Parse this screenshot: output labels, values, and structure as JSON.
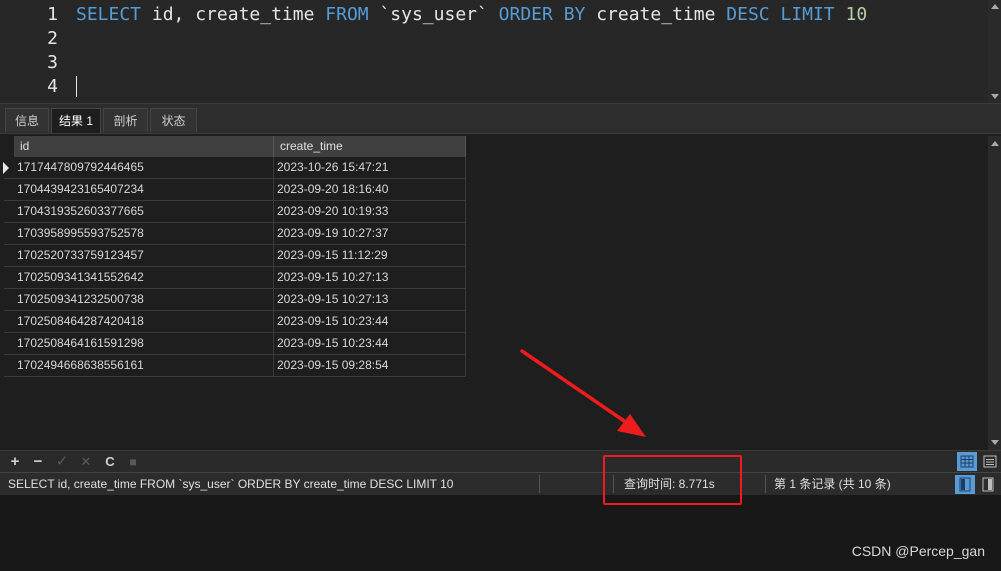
{
  "editor": {
    "line_numbers": [
      "1",
      "2",
      "3",
      "4"
    ],
    "sql_tokens": [
      {
        "text": "SELECT",
        "kind": "kw"
      },
      {
        "text": " id, create_time ",
        "kind": "id"
      },
      {
        "text": "FROM",
        "kind": "kw"
      },
      {
        "text": " `sys_user` ",
        "kind": "id"
      },
      {
        "text": "ORDER BY",
        "kind": "kw"
      },
      {
        "text": " create_time ",
        "kind": "id"
      },
      {
        "text": "DESC LIMIT",
        "kind": "kw"
      },
      {
        "text": " ",
        "kind": "id"
      },
      {
        "text": "10",
        "kind": "num"
      }
    ]
  },
  "tabs": [
    {
      "label": "信息",
      "active": false
    },
    {
      "label": "结果 1",
      "active": true
    },
    {
      "label": "剖析",
      "active": false
    },
    {
      "label": "状态",
      "active": false
    }
  ],
  "grid": {
    "columns": [
      "id",
      "create_time"
    ],
    "rows": [
      [
        "1717447809792446465",
        "2023-10-26 15:47:21"
      ],
      [
        "1704439423165407234",
        "2023-09-20 18:16:40"
      ],
      [
        "1704319352603377665",
        "2023-09-20 10:19:33"
      ],
      [
        "1703958995593752578",
        "2023-09-19 10:27:37"
      ],
      [
        "1702520733759123457",
        "2023-09-15 11:12:29"
      ],
      [
        "1702509341341552642",
        "2023-09-15 10:27:13"
      ],
      [
        "1702509341232500738",
        "2023-09-15 10:27:13"
      ],
      [
        "1702508464287420418",
        "2023-09-15 10:23:44"
      ],
      [
        "1702508464161591298",
        "2023-09-15 10:23:44"
      ],
      [
        "1702494668638556161",
        "2023-09-15 09:28:54"
      ]
    ]
  },
  "toolbar": {
    "add": "+",
    "remove": "−",
    "apply": "✓",
    "discard": "✕",
    "refresh": "C",
    "stop": "■"
  },
  "status": {
    "sql": "SELECT id, create_time FROM `sys_user` ORDER BY create_time DESC LIMIT 10",
    "query_time": "查询时间: 8.771s",
    "records": "第 1 条记录 (共 10 条)"
  },
  "watermark": "CSDN @Percep_gan",
  "colors": {
    "keyword": "#569cd6",
    "number": "#b5cea8",
    "annotation": "#ee1c1c",
    "view_active": "#5b9bd5"
  }
}
